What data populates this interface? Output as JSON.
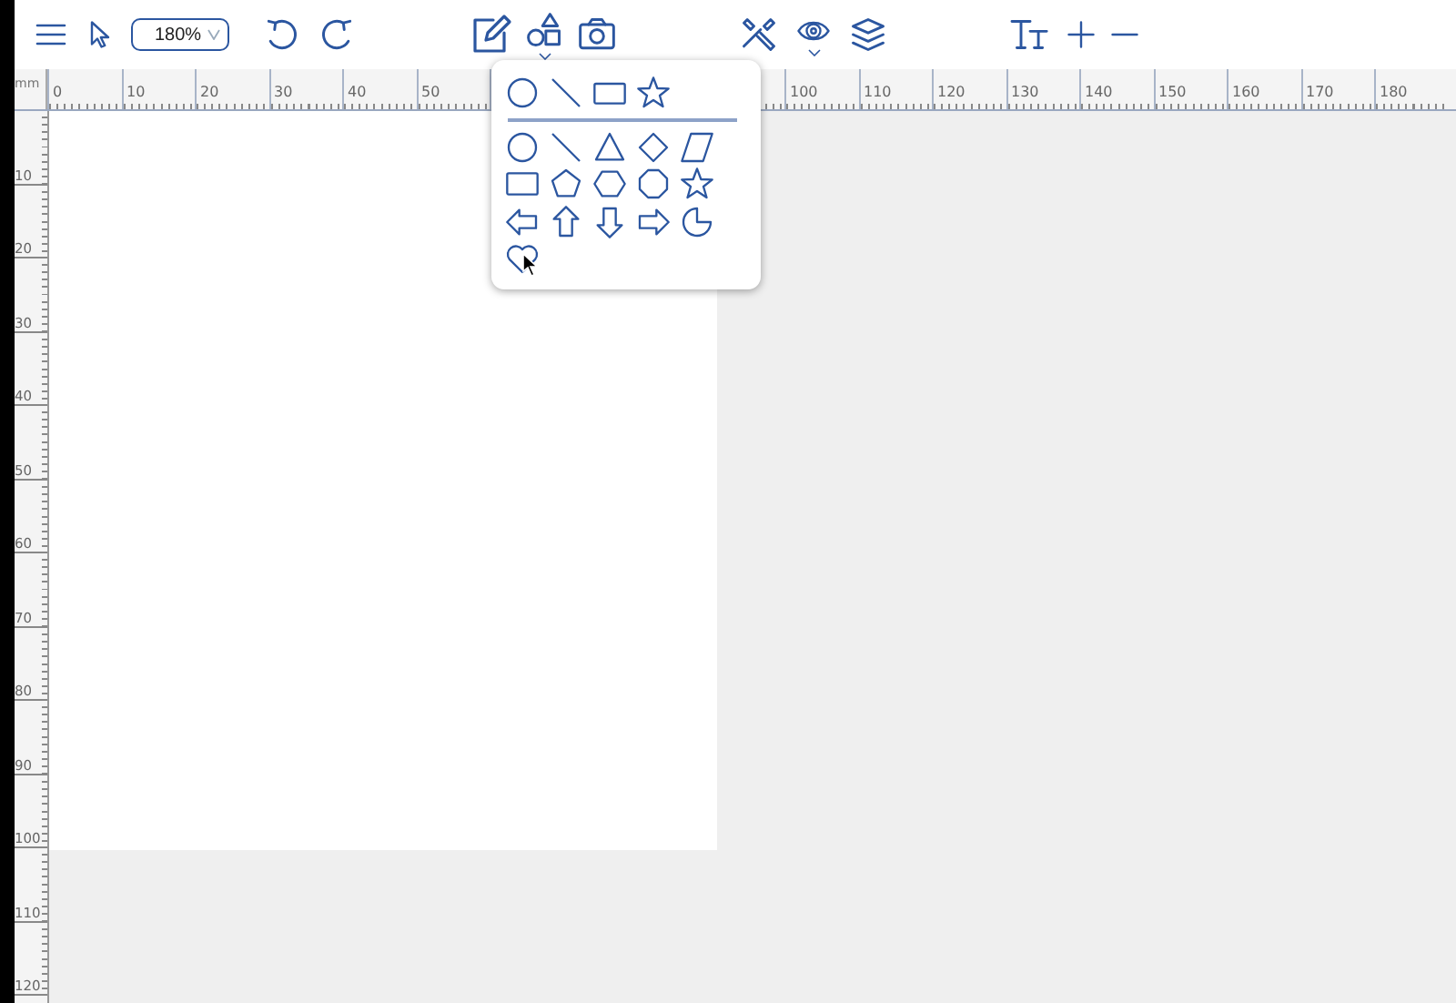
{
  "toolbar": {
    "zoom": {
      "value": "180%"
    }
  },
  "top_ruler": {
    "unit": "mm",
    "segments": [
      {
        "labels": [
          "0",
          "10",
          "20",
          "30",
          "40",
          "50"
        ]
      },
      {
        "labels": [
          "100",
          "110",
          "120",
          "130",
          "140",
          "150",
          "160",
          "170",
          "180"
        ]
      }
    ]
  },
  "left_ruler": {
    "labels": [
      "10",
      "20",
      "30",
      "40",
      "50",
      "60",
      "70",
      "80",
      "90",
      "100",
      "110",
      "120"
    ]
  },
  "shape_menu": {
    "open": true
  }
}
